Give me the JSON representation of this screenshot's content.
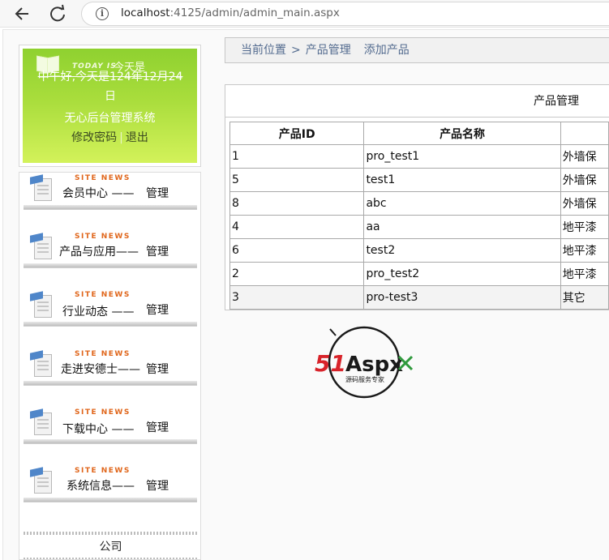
{
  "browser": {
    "back_icon": "arrow-left-icon",
    "reload_icon": "reload-icon",
    "info_icon": "info-icon",
    "url_host": "localhost",
    "url_rest": ":4125/admin/admin_main.aspx"
  },
  "user_panel": {
    "today_label": "TODAY IS",
    "today_cn": "今天是",
    "greeting_line1": "中午好,今天是124年12月24",
    "greeting_line2": "日",
    "system_name": "无心后台管理系统",
    "change_password": "修改密码",
    "separator": "|",
    "logout": "退出"
  },
  "menu": {
    "badge": "SITE NEWS",
    "items": [
      {
        "label": "会员中心  ——",
        "manage": "管理"
      },
      {
        "label": "产品与应用——",
        "manage": "管理"
      },
      {
        "label": "行业动态  ——",
        "manage": "管理"
      },
      {
        "label": "走进安德士——",
        "manage": "管理"
      },
      {
        "label": "下载中心  ——",
        "manage": "管理"
      },
      {
        "label": "系统信息——",
        "manage": "管理"
      }
    ],
    "company": "公司"
  },
  "breadcrumb": {
    "current": "当前位置",
    "sep": ">",
    "section": "产品管理",
    "add": "添加产品"
  },
  "product_panel": {
    "title": "产品管理",
    "columns": [
      "产品ID",
      "产品名称",
      ""
    ],
    "rows": [
      {
        "id": "1",
        "name": "pro_test1",
        "cat": "外墙保"
      },
      {
        "id": "5",
        "name": "test1",
        "cat": "外墙保"
      },
      {
        "id": "8",
        "name": "abc",
        "cat": "外墙保"
      },
      {
        "id": "4",
        "name": "aa",
        "cat": "地平漆"
      },
      {
        "id": "6",
        "name": "test2",
        "cat": "地平漆"
      },
      {
        "id": "2",
        "name": "pro_test2",
        "cat": "地平漆"
      },
      {
        "id": "3",
        "name": "pro-test3",
        "cat": "其它"
      }
    ]
  },
  "logo": {
    "text_51": "51",
    "text_aspx": "Aspx",
    "tagline": "源码服务专家",
    "colors": {
      "red": "#d8232a",
      "black": "#1a1a1a",
      "green": "#2f9a3c"
    }
  }
}
